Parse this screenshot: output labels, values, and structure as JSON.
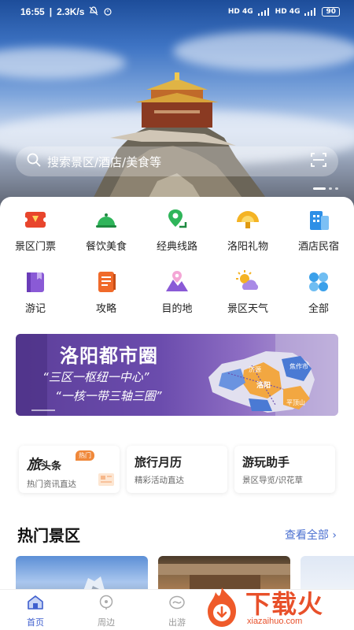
{
  "status_bar": {
    "time": "16:55",
    "speed": "2.3K/s",
    "battery": "90",
    "net1": "HD 4G",
    "net2": "HD 4G"
  },
  "search": {
    "placeholder": "搜索景区/酒店/美食等"
  },
  "grid": [
    {
      "label": "景区门票",
      "icon": "ticket-icon",
      "color": "#e8452c"
    },
    {
      "label": "餐饮美食",
      "icon": "food-cloche-icon",
      "color": "#2fb55a"
    },
    {
      "label": "经典线路",
      "icon": "route-pin-icon",
      "color": "#2fb55a"
    },
    {
      "label": "洛阳礼物",
      "icon": "gift-fan-icon",
      "color": "#f4b324"
    },
    {
      "label": "酒店民宿",
      "icon": "hotel-building-icon",
      "color": "#2e8fe6"
    },
    {
      "label": "游记",
      "icon": "notebook-icon",
      "color": "#8a5ad6"
    },
    {
      "label": "攻略",
      "icon": "guide-book-icon",
      "color": "#f06a2a"
    },
    {
      "label": "目的地",
      "icon": "destination-pin-icon",
      "color": "#8a5ad6"
    },
    {
      "label": "景区天气",
      "icon": "weather-icon",
      "color": "#f4b324"
    },
    {
      "label": "全部",
      "icon": "all-grid-icon",
      "color": "#3aa0ea"
    }
  ],
  "banner": {
    "title": "洛阳都市圈",
    "line1": "“三区一枢纽一中心”",
    "line2": "“一核一带三轴三圈”",
    "map_labels": [
      "济源",
      "焦作市",
      "洛阳",
      "平顶山"
    ]
  },
  "cards": [
    {
      "title_a": "旅",
      "title_b": "头条",
      "badge": "热门",
      "subtitle": "热门资讯直达"
    },
    {
      "title": "旅行月历",
      "subtitle": "精彩活动直达"
    },
    {
      "title": "游玩助手",
      "subtitle": "景区导览/识花草"
    }
  ],
  "section": {
    "title": "热门景区",
    "see_all": "查看全部"
  },
  "tabs": [
    {
      "label": "首页",
      "icon": "home-icon",
      "active": true
    },
    {
      "label": "周边",
      "icon": "nearby-pin-icon",
      "active": false
    },
    {
      "label": "出游",
      "icon": "travel-icon",
      "active": false
    }
  ],
  "watermark": {
    "title": "下载火",
    "site": "xiazaihuo.com"
  }
}
